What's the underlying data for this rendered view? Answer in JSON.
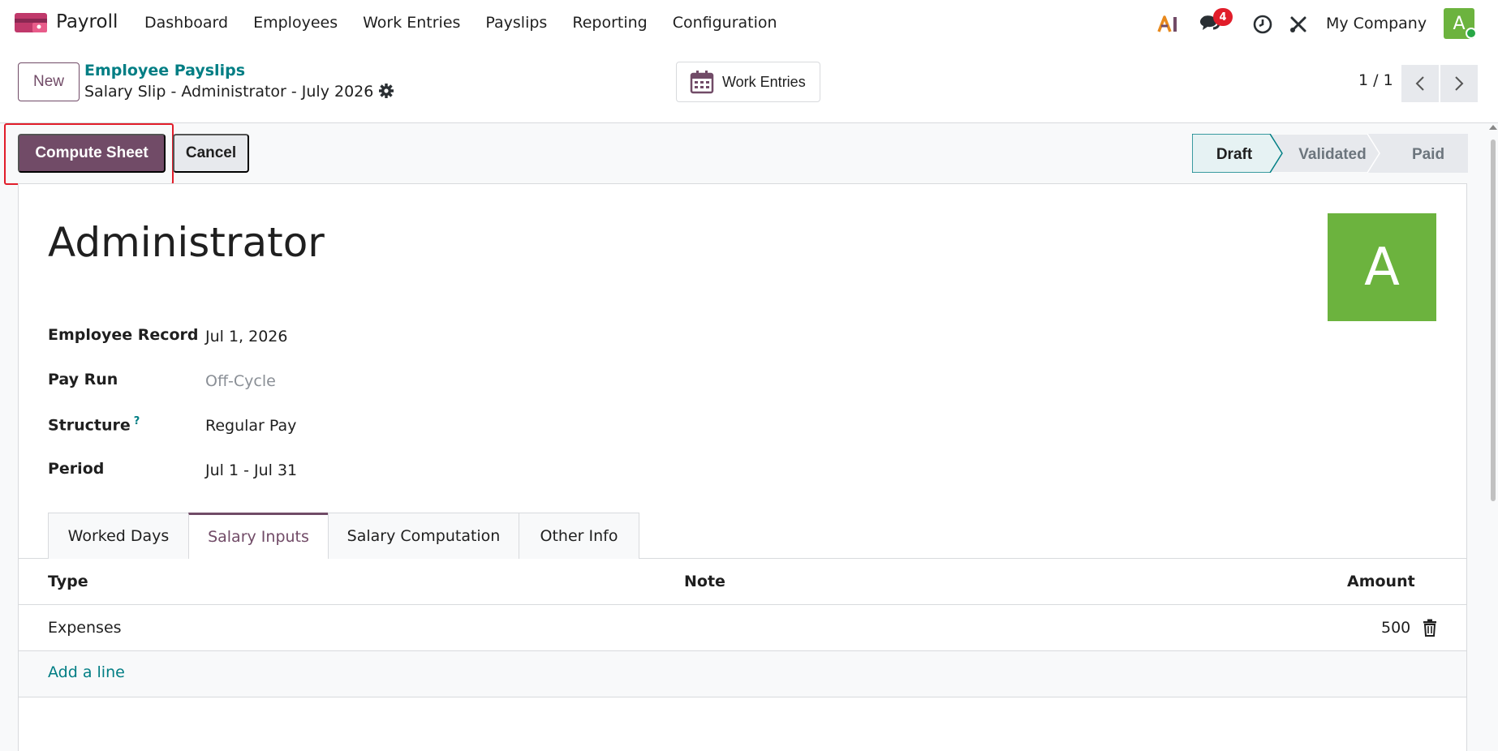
{
  "navbar": {
    "app_name": "Payroll",
    "menu": [
      "Dashboard",
      "Employees",
      "Work Entries",
      "Payslips",
      "Reporting",
      "Configuration"
    ],
    "message_count": "4",
    "company": "My Company",
    "user_initial": "A"
  },
  "control": {
    "new_label": "New",
    "breadcrumb_parent": "Employee Payslips",
    "breadcrumb_current": "Salary Slip - Administrator - July 2026",
    "work_entries_label": "Work Entries",
    "pager": "1 / 1"
  },
  "statusbar": {
    "compute_label": "Compute Sheet",
    "cancel_label": "Cancel",
    "stages": [
      "Draft",
      "Validated",
      "Paid"
    ],
    "current_stage": "Draft"
  },
  "form": {
    "employee_name": "Administrator",
    "avatar_initial": "A",
    "fields": {
      "employee_record_label": "Employee Record",
      "employee_record_value": "Jul 1, 2026",
      "pay_run_label": "Pay Run",
      "pay_run_value": "Off-Cycle",
      "structure_label": "Structure",
      "structure_help": "?",
      "structure_value": "Regular Pay",
      "period_label": "Period",
      "period_value": "Jul 1 - Jul 31"
    },
    "tabs": [
      "Worked Days",
      "Salary Inputs",
      "Salary Computation",
      "Other Info"
    ],
    "active_tab": "Salary Inputs",
    "table": {
      "headers": {
        "type": "Type",
        "note": "Note",
        "amount": "Amount"
      },
      "rows": [
        {
          "type": "Expenses",
          "note": "",
          "amount": "500"
        }
      ],
      "add_line": "Add a line"
    }
  },
  "colors": {
    "brand": "#714b67",
    "link": "#017e84",
    "highlight": "#e11d2a",
    "avatar": "#6cb33e"
  }
}
